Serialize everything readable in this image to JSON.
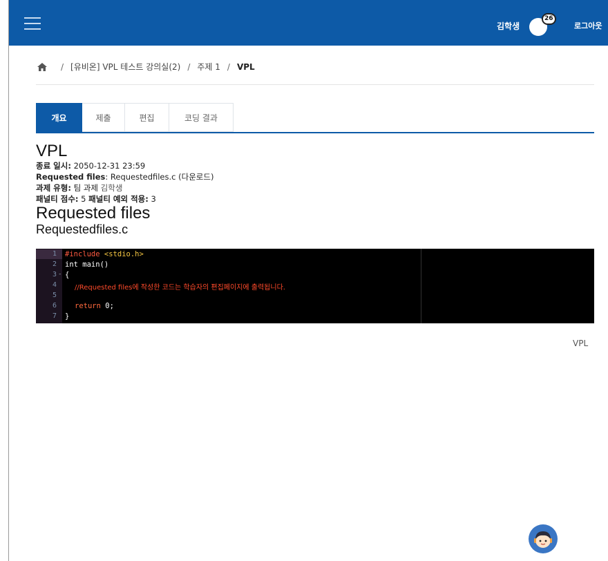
{
  "header": {
    "user_name": "김학생",
    "notification_count": "26",
    "logout_label": "로그아웃",
    "bar_color": "#0d5aa7"
  },
  "breadcrumb": {
    "items": [
      "[유비온] VPL 테스트 강의실(2)",
      "주제 1",
      "VPL"
    ],
    "separator": "/"
  },
  "tabs": [
    {
      "label": "개요",
      "active": true
    },
    {
      "label": "제출",
      "active": false
    },
    {
      "label": "편집",
      "active": false
    },
    {
      "label": "코딩 결과",
      "active": false
    }
  ],
  "main": {
    "title": "VPL",
    "due_label": "종료 일시",
    "due_value": "2050-12-31 23:59",
    "requested_files_label": "Requested files",
    "requested_files_value": "Requestedfiles.c",
    "download_label": "(다운로드)",
    "work_type_label": "과제 유형",
    "work_type_value": "팀 과제",
    "work_type_member": "김학생",
    "penalty_label": "패널티 점수",
    "penalty_value": "5",
    "penalty_exception_label": "패널티 예외 적용",
    "penalty_exception_value": "3",
    "section_heading": "Requested files",
    "file_name": "Requestedfiles.c"
  },
  "code": {
    "line_numbers": [
      "1",
      "2",
      "3",
      "4",
      "5",
      "6",
      "7"
    ],
    "line1_pre": "#include ",
    "line1_str": "<stdio.h>",
    "line2": "int main()",
    "line3": "{",
    "line4": "//Requested files에 작성한 코드는 학습자의 편집페이지에 출력됩니다.",
    "line6_kw": "return",
    "line6_rest": " 0;",
    "line7": "}",
    "fold_marker": "-"
  },
  "footer": {
    "vpl_label": "VPL"
  }
}
